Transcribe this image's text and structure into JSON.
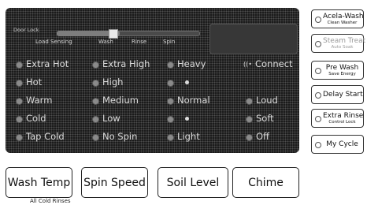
{
  "status": {
    "door_lock": "Door Lock",
    "stages": [
      "Load Sensing",
      "Wash",
      "Rinse",
      "Spin"
    ]
  },
  "columns": {
    "wash_temp": [
      "Extra Hot",
      "Hot",
      "Warm",
      "Cold",
      "Tap Cold"
    ],
    "spin_speed": [
      "Extra High",
      "High",
      "Medium",
      "Low",
      "No Spin"
    ],
    "soil_level": [
      "Heavy",
      "",
      "Normal",
      "",
      "Light"
    ],
    "chime": [
      "Connect",
      "",
      "Loud",
      "Soft",
      "Off"
    ]
  },
  "side_buttons": [
    {
      "title": "Acela-Wash",
      "subtitle": "Clean Washer",
      "enabled": true
    },
    {
      "title": "Steam Treat",
      "subtitle": "Auto Soak",
      "enabled": false
    },
    {
      "title": "Pre Wash",
      "subtitle": "Save Energy",
      "enabled": true
    },
    {
      "title": "Delay Start",
      "subtitle": "",
      "enabled": true
    },
    {
      "title": "Extra Rinse",
      "subtitle": "Control Lock",
      "enabled": true
    },
    {
      "title": "My Cycle",
      "subtitle": "",
      "enabled": true
    }
  ],
  "bottom_buttons": [
    "Wash Temp",
    "Spin Speed",
    "Soil Level",
    "Chime"
  ],
  "footnote": "All Cold Rinses"
}
